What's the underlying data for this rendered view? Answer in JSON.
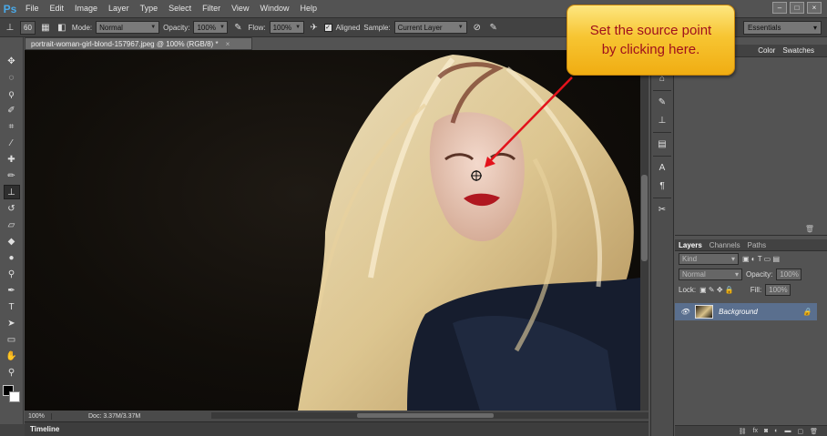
{
  "app": {
    "logo": "Ps"
  },
  "menu": [
    "File",
    "Edit",
    "Image",
    "Layer",
    "Type",
    "Select",
    "Filter",
    "View",
    "Window",
    "Help"
  ],
  "window_controls": [
    "–",
    "□",
    "×"
  ],
  "options": {
    "brush_size": "60",
    "mode_label": "Mode:",
    "mode_value": "Normal",
    "opacity_label": "Opacity:",
    "opacity_value": "100%",
    "flow_label": "Flow:",
    "flow_value": "100%",
    "aligned_label": "Aligned",
    "aligned_checked": true,
    "sample_label": "Sample:",
    "sample_value": "Current Layer",
    "workspace": "Essentials"
  },
  "document": {
    "tab_title": "portrait-woman-girl-blond-157967.jpeg @ 100% (RGB/8) *",
    "zoom": "100%",
    "doc_size": "Doc: 3.37M/3.37M"
  },
  "timeline_label": "Timeline",
  "panels": {
    "top_tabs": [
      "Color",
      "Swatches"
    ],
    "layers_tabs": [
      "Layers",
      "Channels",
      "Paths"
    ],
    "kind_label": "Kind",
    "blend_mode": "Normal",
    "opacity_label": "Opacity:",
    "opacity_value": "100%",
    "lock_label": "Lock:",
    "fill_label": "Fill:",
    "fill_value": "100%",
    "layer_name": "Background"
  },
  "callout": {
    "line1": "Set the source point",
    "line2": "by clicking here."
  },
  "colors": {
    "callout_text": "#a0101c",
    "arrow": "#e3121b",
    "callout_fill": "#f7c532",
    "selected_layer": "#5a6f8e"
  }
}
